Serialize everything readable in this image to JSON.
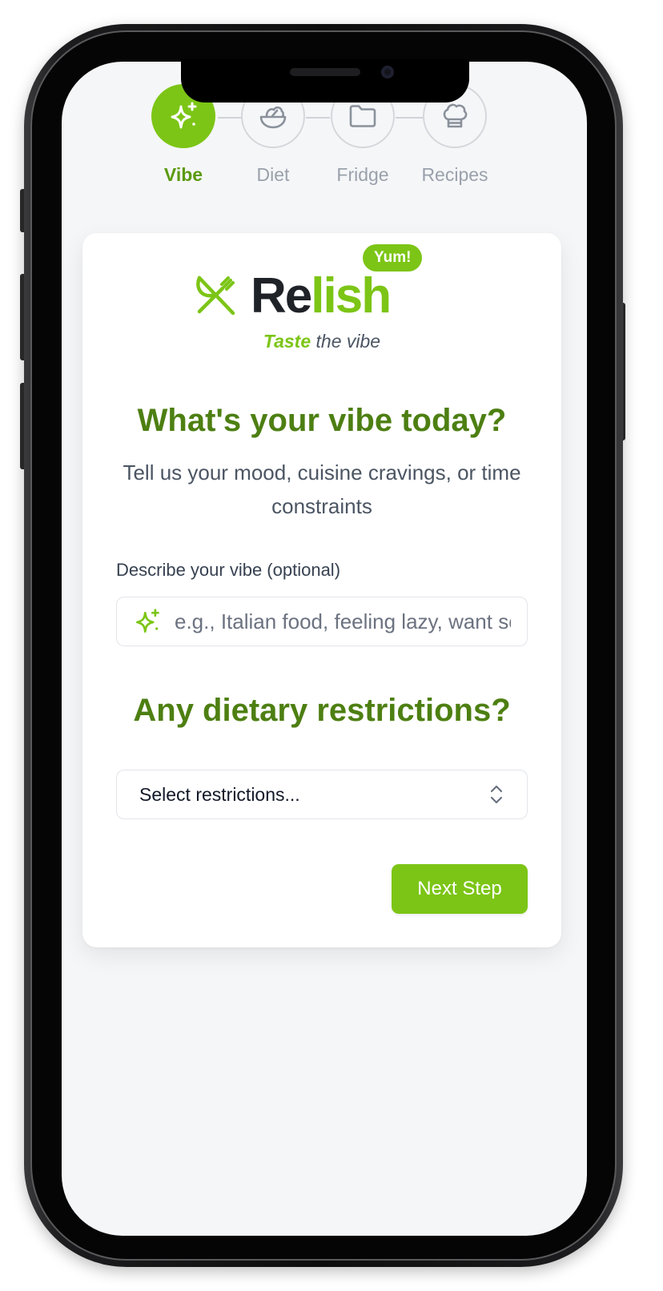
{
  "stepper": {
    "steps": [
      {
        "label": "Vibe",
        "icon": "sparkles-icon",
        "active": true
      },
      {
        "label": "Diet",
        "icon": "salad-bowl-icon",
        "active": false
      },
      {
        "label": "Fridge",
        "icon": "folder-icon",
        "active": false
      },
      {
        "label": "Recipes",
        "icon": "chef-hat-icon",
        "active": false
      }
    ]
  },
  "brand": {
    "name_dark": "Re",
    "name_light": "lish",
    "badge": "Yum!",
    "logo_icon": "fork-knife-icon",
    "tagline_highlight": "Taste",
    "tagline_rest": " the vibe"
  },
  "vibe_section": {
    "title": "What's your vibe today?",
    "subtitle": "Tell us your mood, cuisine cravings, or time constraints",
    "field_label": "Describe your vibe (optional)",
    "field_icon": "sparkles-icon",
    "placeholder": "e.g., Italian food, feeling lazy, want something quick",
    "value": ""
  },
  "diet_section": {
    "title": "Any dietary restrictions?",
    "select_value": "Select restrictions...",
    "select_icon": "chevron-up-down-icon"
  },
  "actions": {
    "next_label": "Next Step"
  },
  "colors": {
    "accent": "#7cc516",
    "heading": "#4d7f12",
    "background": "#f5f6f8"
  }
}
